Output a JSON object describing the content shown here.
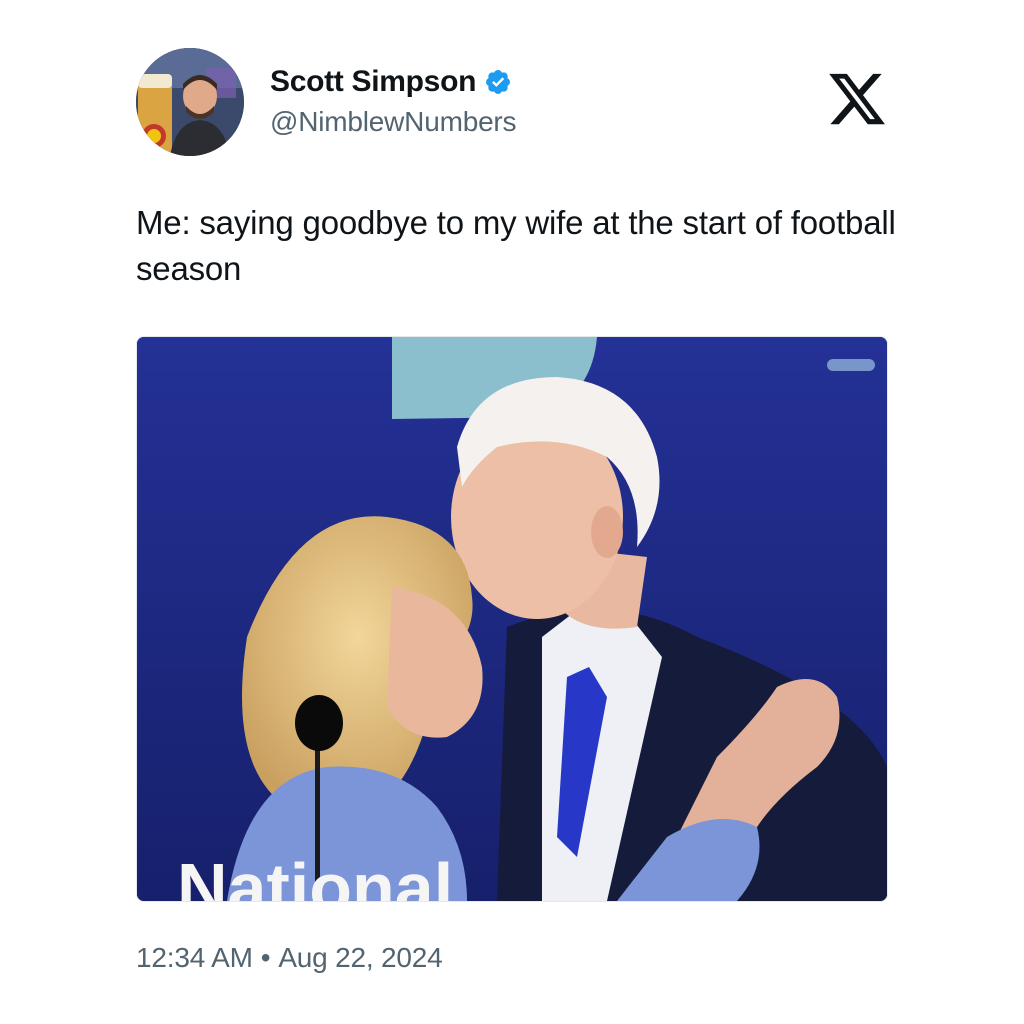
{
  "author": {
    "display_name": "Scott Simpson",
    "handle": "@NimblewNumbers",
    "verified": true,
    "avatar_icon": "profile-photo"
  },
  "platform": {
    "logo_icon": "x-logo-icon"
  },
  "tweet": {
    "text": "Me: saying goodbye to my wife at the start of football season",
    "media": {
      "type": "photo",
      "caption_text_in_image": "National"
    }
  },
  "meta": {
    "time": "12:34 AM",
    "separator": "•",
    "date": "Aug 22, 2024"
  },
  "colors": {
    "verified_blue": "#1d9bf0",
    "secondary_text": "#536471",
    "primary_text": "#0f1419",
    "stage_blue": "#1e2a86"
  }
}
